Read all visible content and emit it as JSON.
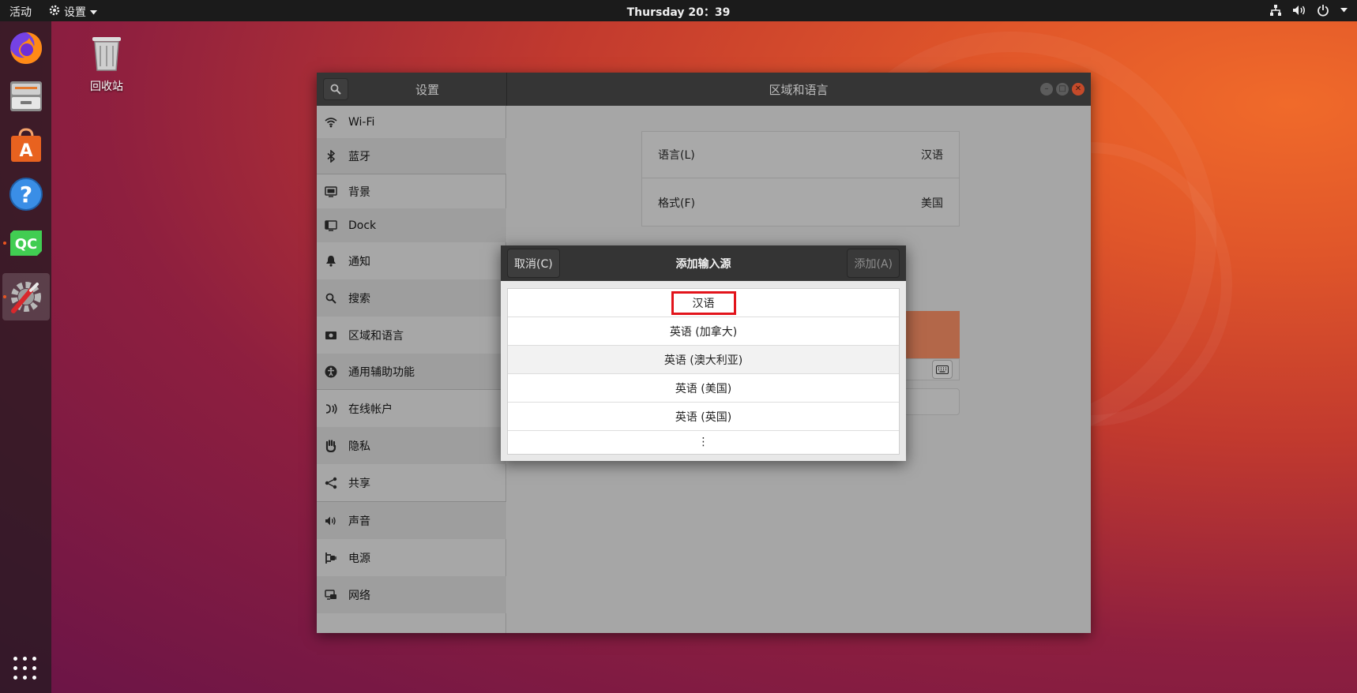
{
  "topbar": {
    "activities": "活动",
    "app_menu": "设置",
    "clock": "Thursday 20：39"
  },
  "desktop": {
    "trash_label": "回收站"
  },
  "window": {
    "sidebar_title": "设置",
    "main_title": "区域和语言"
  },
  "sidebar": {
    "items": [
      {
        "label": "Wi-Fi",
        "icon": "wifi-icon"
      },
      {
        "label": "蓝牙",
        "icon": "bluetooth-icon"
      },
      {
        "label": "背景",
        "icon": "background-icon"
      },
      {
        "label": "Dock",
        "icon": "dock-icon"
      },
      {
        "label": "通知",
        "icon": "bell-icon"
      },
      {
        "label": "搜索",
        "icon": "search-icon"
      },
      {
        "label": "区域和语言",
        "icon": "flag-icon"
      },
      {
        "label": "通用辅助功能",
        "icon": "accessibility-icon"
      },
      {
        "label": "在线帐户",
        "icon": "online-accounts-icon"
      },
      {
        "label": "隐私",
        "icon": "hand-icon"
      },
      {
        "label": "共享",
        "icon": "share-icon"
      },
      {
        "label": "声音",
        "icon": "speaker-icon"
      },
      {
        "label": "电源",
        "icon": "power-plug-icon"
      },
      {
        "label": "网络",
        "icon": "network-icon"
      }
    ]
  },
  "region": {
    "language_label": "语言(L)",
    "language_value": "汉语",
    "format_label": "格式(F)",
    "format_value": "美国"
  },
  "dialog": {
    "cancel": "取消(C)",
    "title": "添加输入源",
    "add": "添加(A)",
    "options": [
      "汉语",
      "英语 (加拿大)",
      "英语 (澳大利亚)",
      "英语 (美国)",
      "英语 (英国)"
    ],
    "more": "⋮"
  },
  "colors": {
    "accent": "#e95420",
    "highlight_box": "#e2141b",
    "selected_row": "#b36749"
  }
}
